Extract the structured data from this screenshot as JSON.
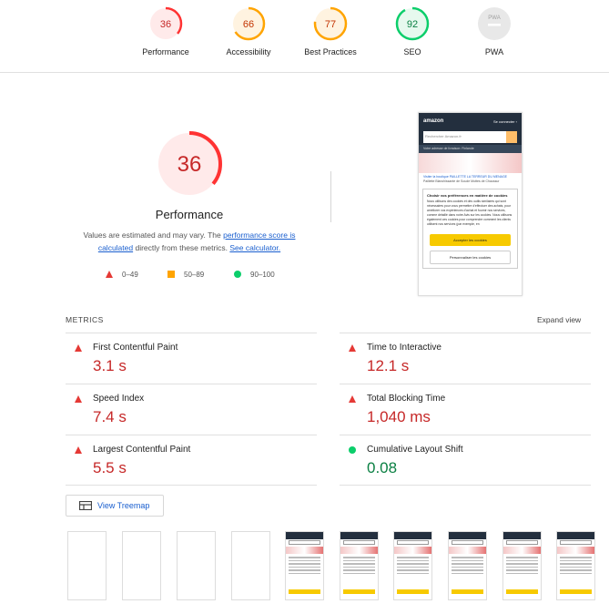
{
  "gauges": [
    {
      "name": "Performance",
      "score": "36",
      "color": "#ff3333",
      "bg": "#ffeaea",
      "text_color": "#c62828",
      "fraction": 0.36
    },
    {
      "name": "Accessibility",
      "score": "66",
      "color": "#ffa400",
      "bg": "#fff3e0",
      "text_color": "#c33300",
      "fraction": 0.66
    },
    {
      "name": "Best Practices",
      "score": "77",
      "color": "#ffa400",
      "bg": "#fff3e0",
      "text_color": "#c33300",
      "fraction": 0.77
    },
    {
      "name": "SEO",
      "score": "92",
      "color": "#0cce6b",
      "bg": "#e6f9ee",
      "text_color": "#0b8043",
      "fraction": 0.92
    },
    {
      "name": "PWA",
      "score": "PWA",
      "color": "#bdbdbd",
      "bg": "#e8e8e8",
      "text_color": "#9e9e9e",
      "fraction": 0
    }
  ],
  "hero": {
    "score": "36",
    "title": "Performance",
    "desc_prefix": "Values are estimated and may vary. The ",
    "desc_link": "performance score is calculated",
    "desc_mid": " directly from these metrics. ",
    "desc_link2": "See calculator."
  },
  "legend": {
    "red": "0–49",
    "orange": "50–89",
    "green": "90–100"
  },
  "screenshot": {
    "logo": "amazon",
    "nav": "Se connecter ›",
    "search_placeholder": "Rechercher Amazon.fr",
    "location": "Votre adresse de livraison: Finlande",
    "product": "Visiter la boutique PAILLETTE LA TERREUR DU MENAGE",
    "product_sub": "Paillette Blanchissante de Soude Mottes de Chaussur",
    "dialog_title": "Choisir vos préférences en matière de cookies",
    "dialog_text": "Nous utilisons des cookies et des outils similaires qui sont nécessaires pour vous permettre d'effectuer des achats, pour améliorer vos expériences d'achat et fournir nos services, comme détaillé dans notre Avis sur les cookies. Nous utilisons également ces cookies pour comprendre comment les clients utilisent nos services (par exemple, en",
    "accept": "Accepter les cookies",
    "customize": "Personnaliser les cookies"
  },
  "metrics": {
    "header": "METRICS",
    "expand": "Expand view",
    "items": [
      {
        "name": "First Contentful Paint",
        "value": "3.1 s",
        "status": "red"
      },
      {
        "name": "Time to Interactive",
        "value": "12.1 s",
        "status": "red"
      },
      {
        "name": "Speed Index",
        "value": "7.4 s",
        "status": "red"
      },
      {
        "name": "Total Blocking Time",
        "value": "1,040 ms",
        "status": "red"
      },
      {
        "name": "Largest Contentful Paint",
        "value": "5.5 s",
        "status": "red"
      },
      {
        "name": "Cumulative Layout Shift",
        "value": "0.08",
        "status": "green"
      }
    ]
  },
  "treemap": {
    "label": "View Treemap"
  },
  "filmstrip": {
    "blank_frames": 4,
    "loaded_frames": 6
  }
}
